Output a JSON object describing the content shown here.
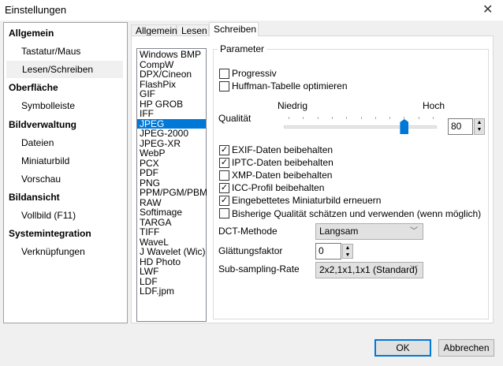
{
  "window": {
    "title": "Einstellungen",
    "close": "✕"
  },
  "tree": [
    {
      "label": "Allgemein",
      "level": 0
    },
    {
      "label": "Tastatur/Maus",
      "level": 1
    },
    {
      "label": "Lesen/Schreiben",
      "level": 1,
      "selected": true
    },
    {
      "label": "Oberfläche",
      "level": 0
    },
    {
      "label": "Symbolleiste",
      "level": 1
    },
    {
      "label": "Bildverwaltung",
      "level": 0
    },
    {
      "label": "Dateien",
      "level": 1
    },
    {
      "label": "Miniaturbild",
      "level": 1
    },
    {
      "label": "Vorschau",
      "level": 1
    },
    {
      "label": "Bildansicht",
      "level": 0
    },
    {
      "label": "Vollbild  (F11)",
      "level": 1
    },
    {
      "label": "Systemintegration",
      "level": 0
    },
    {
      "label": "Verknüpfungen",
      "level": 1
    }
  ],
  "tabs": [
    "Allgemein",
    "Lesen",
    "Schreiben"
  ],
  "formats": [
    "Windows BMP",
    "CompW",
    "DPX/Cineon",
    "FlashPix",
    "GIF",
    "HP GROB",
    "IFF",
    "JPEG",
    "JPEG-2000",
    "JPEG-XR",
    "WebP",
    "PCX",
    "PDF",
    "PNG",
    "PPM/PGM/PBM",
    "RAW",
    "Softimage",
    "TARGA",
    "TIFF",
    "WaveL",
    "J Wavelet (Wic)",
    "HD Photo",
    "LWF",
    "LDF",
    "LDF.jpm"
  ],
  "selected_format": "JPEG",
  "params": {
    "group": "Parameter",
    "progressive": {
      "label": "Progressiv",
      "checked": false
    },
    "huffman": {
      "label": "Huffman-Tabelle optimieren",
      "checked": false
    },
    "quality_label": "Qualität",
    "low": "Niedrig",
    "high": "Hoch",
    "quality": "80",
    "quality_min": 0,
    "quality_max": 100,
    "checks": [
      {
        "label": "EXIF-Daten beibehalten",
        "checked": true
      },
      {
        "label": "IPTC-Daten beibehalten",
        "checked": true
      },
      {
        "label": "XMP-Daten beibehalten",
        "checked": false
      },
      {
        "label": "ICC-Profil beibehalten",
        "checked": true
      },
      {
        "label": "Eingebettetes Miniaturbild erneuern",
        "checked": true
      },
      {
        "label": "Bisherige Qualität schätzen und verwenden (wenn möglich)",
        "checked": false
      }
    ],
    "dct_label": "DCT-Methode",
    "dct_value": "Langsam",
    "smooth_label": "Glättungsfaktor",
    "smooth_value": "0",
    "sub_label": "Sub-sampling-Rate",
    "sub_value": "2x2,1x1,1x1 (Standard)"
  },
  "buttons": {
    "ok": "OK",
    "cancel": "Abbrechen"
  }
}
